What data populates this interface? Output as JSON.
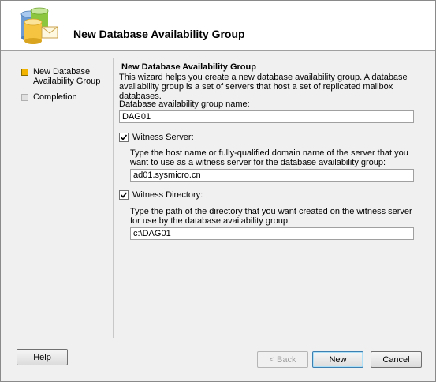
{
  "header": {
    "title": "New Database Availability Group"
  },
  "nav": {
    "items": [
      {
        "label": "New Database Availability Group",
        "state": "current"
      },
      {
        "label": "Completion",
        "state": "pending"
      }
    ]
  },
  "content": {
    "title": "New Database Availability Group",
    "description": "This wizard helps you create a new database availability group. A database availability group is a set of servers that host a set of replicated mailbox databases.",
    "dag_name": {
      "label": "Database availability group name:",
      "value": "DAG01"
    },
    "witness_server": {
      "checkbox_label": "Witness Server:",
      "checked": true,
      "description": "Type the host name or fully-qualified domain name of the server that you want to use as a witness server for the database availability group:",
      "value": "ad01.sysmicro.cn"
    },
    "witness_directory": {
      "checkbox_label": "Witness Directory:",
      "checked": true,
      "description": "Type the path of the directory that you want created on the witness server for use by the database availability group:",
      "value": "c:\\DAG01"
    }
  },
  "footer": {
    "help_label": "Help",
    "back_label": "< Back",
    "new_label": "New",
    "cancel_label": "Cancel"
  },
  "icons": {
    "header": "database-group-icon",
    "checkbox": "check-icon"
  },
  "colors": {
    "current_step": "#f2b200",
    "pending_step": "#e0e0e0",
    "default_button_border": "#3c7fb1"
  }
}
